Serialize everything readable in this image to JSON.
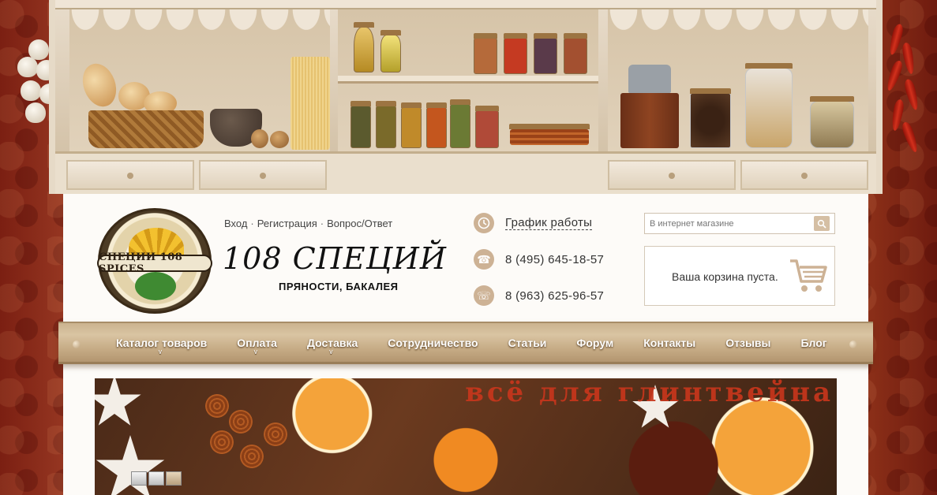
{
  "site": {
    "brand_title": "108 СПЕЦИЙ",
    "brand_subtitle": "ПРЯНОСТИ, БАКАЛЕЯ",
    "logo_text": "СПЕЦИИ 108 SPICES"
  },
  "top_links": {
    "login": "Вход",
    "register": "Регистрация",
    "faq": "Вопрос/Ответ",
    "separator": "·"
  },
  "contacts": {
    "schedule_label": "График работы",
    "phone_1": "8 (495) 645-18-57",
    "phone_2": "8 (963) 625-96-57"
  },
  "search": {
    "placeholder": "В интернет магазине"
  },
  "cart": {
    "status": "Ваша корзина пуста."
  },
  "nav": {
    "items": [
      {
        "label": "Каталог товаров",
        "has_submenu": true
      },
      {
        "label": "Оплата",
        "has_submenu": true
      },
      {
        "label": "Доставка",
        "has_submenu": true
      },
      {
        "label": "Сотрудничество",
        "has_submenu": false
      },
      {
        "label": "Статьи",
        "has_submenu": false
      },
      {
        "label": "Форум",
        "has_submenu": false
      },
      {
        "label": "Контакты",
        "has_submenu": false
      },
      {
        "label": "Отзывы",
        "has_submenu": false
      },
      {
        "label": "Блог",
        "has_submenu": false
      }
    ],
    "chevron": "v"
  },
  "banner": {
    "headline": "всё для глинтвейна",
    "slides_count": 3,
    "active_slide": 3
  },
  "colors": {
    "accent": "#cdb295",
    "banner_text": "#c7361c",
    "nav_wood": "#c4a983",
    "background_fabric": "#7b1f12"
  },
  "icons": {
    "schedule": "clock-icon",
    "phone_1": "phone-icon",
    "phone_2": "phone-icon",
    "search": "magnifier-icon",
    "cart": "cart-icon"
  }
}
